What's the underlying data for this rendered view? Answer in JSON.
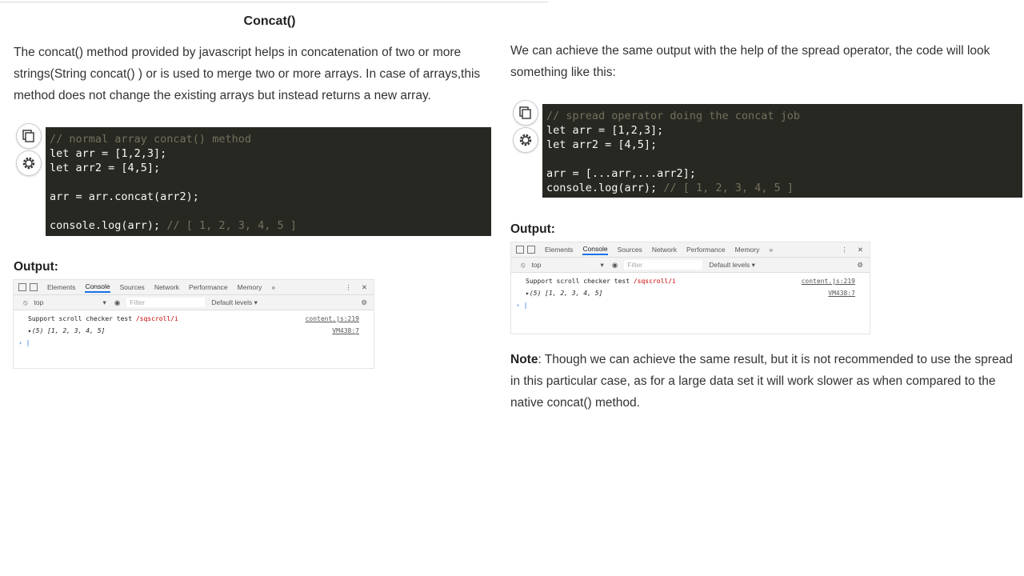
{
  "section_title": "Concat()",
  "left": {
    "intro_lines": [
      "The concat() method provided by javascript helps in concatenation of two or more",
      "strings(String concat() ) or is used to merge two or more arrays. In case of arrays,this",
      "method does not change the existing arrays but instead returns a new array."
    ],
    "code": [
      {
        "code": "",
        "comment": "// normal array concat() method"
      },
      {
        "code": "let arr = [1,2,3];",
        "comment": ""
      },
      {
        "code": "let arr2 = [4,5];",
        "comment": ""
      },
      {
        "code": "",
        "comment": ""
      },
      {
        "code": "arr = arr.concat(arr2);",
        "comment": ""
      },
      {
        "code": "",
        "comment": ""
      },
      {
        "code": "console.log(arr); ",
        "comment": "// [ 1, 2, 3, 4, 5 ]"
      }
    ],
    "output_label": "Output:"
  },
  "right": {
    "intro_lines": [
      "We can achieve the same output with the help of the spread operator, the code will look",
      "something like this:"
    ],
    "code": [
      {
        "code": "",
        "comment": "// spread operator doing the concat job"
      },
      {
        "code": "let arr = [1,2,3];",
        "comment": ""
      },
      {
        "code": "let arr2 = [4,5];",
        "comment": ""
      },
      {
        "code": "",
        "comment": ""
      },
      {
        "code": "arr = [...arr,...arr2];",
        "comment": ""
      },
      {
        "code": "console.log(arr); ",
        "comment": "// [ 1, 2, 3, 4, 5 ]"
      }
    ],
    "output_label": "Output:",
    "note_bold": "Note",
    "note_text": ": Though we can achieve the same result, but it is not recommended to use the spread in this particular case, as for a large data set it will work slower as when compared to the native concat() method."
  },
  "devtools": {
    "tabs": [
      "Elements",
      "Console",
      "Sources",
      "Network",
      "Performance",
      "Memory"
    ],
    "more": "»",
    "context": "top",
    "filter_placeholder": "Filter",
    "levels": "Default levels ▾",
    "log_text": "Support scroll checker test ",
    "log_path": "/sqscroll/i",
    "log_source": "content.js:219",
    "result": "▸(5) [1, 2, 3, 4, 5]",
    "result_source": "VM438:7",
    "prompt": "› |"
  }
}
